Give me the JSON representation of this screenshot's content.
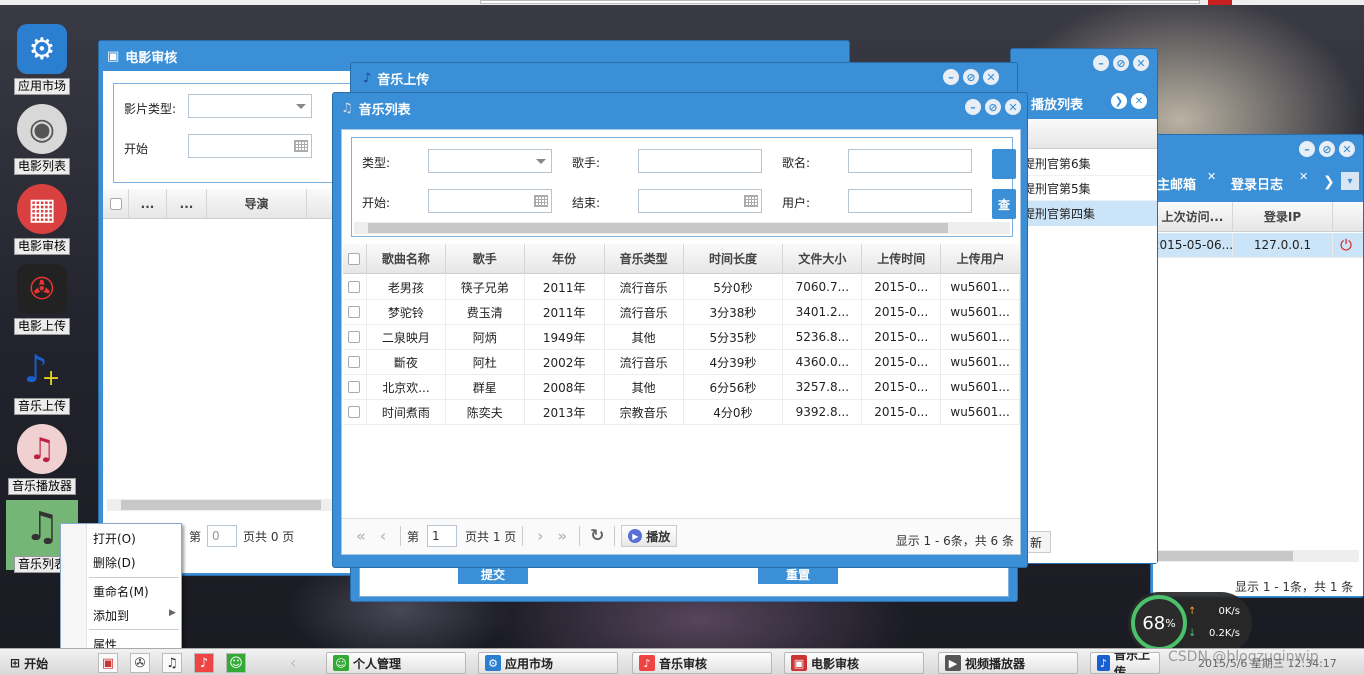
{
  "desktop": {
    "icons": [
      {
        "label": "应用市场",
        "icon": "gear-icon"
      },
      {
        "label": "电影列表",
        "icon": "disc-icon"
      },
      {
        "label": "电影审核",
        "icon": "film-icon"
      },
      {
        "label": "电影上传",
        "icon": "film-reel-icon"
      },
      {
        "label": "音乐上传",
        "icon": "music-note-plus-icon"
      },
      {
        "label": "音乐播放器",
        "icon": "music-player-icon"
      },
      {
        "label": "音乐列表",
        "icon": "music-list-icon"
      }
    ]
  },
  "context_menu": {
    "items": [
      "打开(O)",
      "删除(D)",
      "重命名(M)",
      "添加到",
      "属性"
    ]
  },
  "movie_review_window": {
    "title": "电影审核",
    "film_type_label": "影片类型:",
    "start_label": "开始",
    "columns": [
      "...",
      "...",
      "导演"
    ],
    "pager_page": "第",
    "pager_page_value": "0",
    "pager_total": "页共 0 页"
  },
  "music_upload_window": {
    "title": "音乐上传",
    "submit_label": "提交",
    "reset_label": "重置"
  },
  "playlist_window": {
    "title": "播放列表",
    "items": [
      "提刑官第6集",
      "提刑官第5集",
      "提刑官第四集"
    ]
  },
  "log_window": {
    "tabs": [
      "主邮箱",
      "登录日志"
    ],
    "columns": [
      "上次访问...",
      "登录IP"
    ],
    "row": {
      "time": "2015-05-06...",
      "ip": "127.0.0.1"
    },
    "pager_text": "显示 1 - 1条，共 1 条",
    "new_label": "新"
  },
  "music_list_window": {
    "title": "音乐列表",
    "filters": {
      "type_label": "类型:",
      "singer_label": "歌手:",
      "song_label": "歌名:",
      "start_label": "开始:",
      "end_label": "结束:",
      "user_label": "用户:",
      "search_btn": "查"
    },
    "columns": [
      "歌曲名称",
      "歌手",
      "年份",
      "音乐类型",
      "时间长度",
      "文件大小",
      "上传时间",
      "上传用户"
    ],
    "rows": [
      [
        "老男孩",
        "筷子兄弟",
        "2011年",
        "流行音乐",
        "5分0秒",
        "7060.7...",
        "2015-0...",
        "wu5601..."
      ],
      [
        "梦驼铃",
        "费玉清",
        "2011年",
        "流行音乐",
        "3分38秒",
        "3401.2...",
        "2015-0...",
        "wu5601..."
      ],
      [
        "二泉映月",
        "阿炳",
        "1949年",
        "其他",
        "5分35秒",
        "5236.8...",
        "2015-0...",
        "wu5601..."
      ],
      [
        "斷夜",
        "阿杜",
        "2002年",
        "流行音乐",
        "4分39秒",
        "4360.0...",
        "2015-0...",
        "wu5601..."
      ],
      [
        "北京欢...",
        "群星",
        "2008年",
        "其他",
        "6分56秒",
        "3257.8...",
        "2015-0...",
        "wu5601..."
      ],
      [
        "时间煮雨",
        "陈奕夫",
        "2013年",
        "宗教音乐",
        "4分0秒",
        "9392.8...",
        "2015-0...",
        "wu5601..."
      ]
    ],
    "pager": {
      "page_label": "第",
      "page_value": "1",
      "total_label": "页共 1 页",
      "play_label": "播放",
      "summary": "显示 1 - 6条，共 6 条"
    }
  },
  "taskbar": {
    "start_label": "开始",
    "items": [
      "个人管理",
      "应用市场",
      "音乐审核",
      "电影审核",
      "视频播放器",
      "音乐上传"
    ],
    "clock": "2015/5/6 星期三 12:34:17",
    "watermark": "CSDN @blogzuqinwip"
  },
  "gauge": {
    "percent": "68",
    "percent_sign": "%",
    "up_speed": "0K/s",
    "down_speed": "0.2K/s"
  },
  "colors": {
    "window_blue": "#3a8fd6",
    "selection_blue": "#cce4f7"
  }
}
